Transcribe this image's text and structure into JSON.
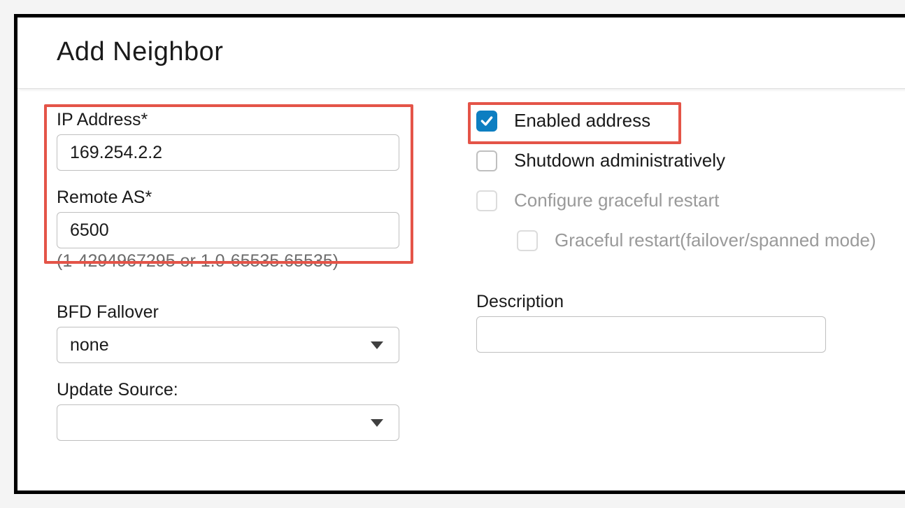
{
  "dialog": {
    "title": "Add Neighbor"
  },
  "left": {
    "ip_label": "IP Address*",
    "ip_value": "169.254.2.2",
    "remote_as_label": "Remote AS*",
    "remote_as_value": "6500",
    "remote_as_hint": "(1-4294967295 or 1.0-65535.65535)",
    "bfd_label": "BFD Fallover",
    "bfd_value": "none",
    "update_src_label": "Update Source:",
    "update_src_value": ""
  },
  "right": {
    "enabled_label": "Enabled address",
    "enabled_checked": true,
    "shutdown_label": "Shutdown administratively",
    "shutdown_checked": false,
    "graceful_restart_label": "Configure graceful restart",
    "graceful_restart_checked": false,
    "graceful_restart_disabled": true,
    "graceful_failover_label": "Graceful restart(failover/spanned mode)",
    "graceful_failover_checked": false,
    "graceful_failover_disabled": true,
    "description_label": "Description",
    "description_value": ""
  },
  "colors": {
    "checkbox_checked": "#0d7ec1",
    "highlight_border": "#e45448"
  }
}
